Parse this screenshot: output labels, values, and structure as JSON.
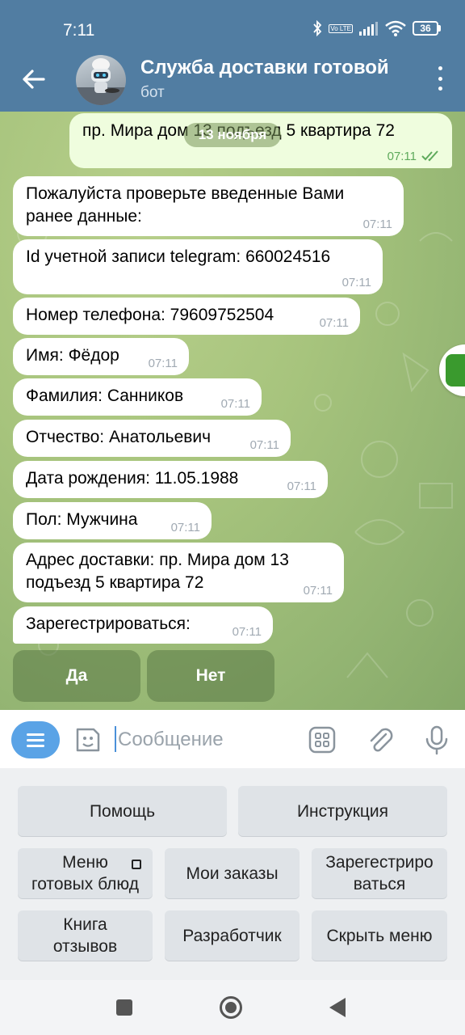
{
  "status_bar": {
    "time": "7:11",
    "battery": "36",
    "volte": "Vo LTE"
  },
  "header": {
    "title": "Служба доставки готовой",
    "subtitle": "бот"
  },
  "chat": {
    "date_pill": "13 ноября",
    "outgoing_partial": {
      "text": "пр. Мира дом 13 подъезд 5 квартира 72",
      "time": "07:11"
    },
    "messages": [
      {
        "line1": "Пожалуйста проверьте введенные Вами",
        "line2": "ранее данные:",
        "time": "07:11"
      },
      {
        "text": "Id учетной записи telegram: 660024516",
        "time": "07:11"
      },
      {
        "text": "Номер телефона: 79609752504",
        "time": "07:11"
      },
      {
        "text": "Имя: Фёдор",
        "time": "07:11"
      },
      {
        "text": "Фамилия: Санников",
        "time": "07:11"
      },
      {
        "text": "Отчество: Анатольевич",
        "time": "07:11"
      },
      {
        "text": "Дата рождения: 11.05.1988",
        "time": "07:11"
      },
      {
        "text": "Пол: Мужчина",
        "time": "07:11"
      },
      {
        "line1": "Адрес доставки: пр. Мира дом 13",
        "line2": "подъезд 5 квартира 72",
        "time": "07:11"
      },
      {
        "text": "Зарегестрироваться:",
        "time": "07:11"
      }
    ],
    "inline_buttons": [
      "Да",
      "Нет"
    ]
  },
  "input": {
    "placeholder": "Сообщение"
  },
  "reply_keyboard": {
    "help": "Помощь",
    "instruction": "Инструкция",
    "menu_line1": "Меню",
    "menu_line2": "готовых блюд",
    "my_orders": "Мои заказы",
    "register_line1": "Зарегестриро",
    "register_line2": "ваться",
    "reviews_line1": "Книга",
    "reviews_line2": "отзывов",
    "developer": "Разработчик",
    "hide_menu": "Скрыть меню"
  }
}
